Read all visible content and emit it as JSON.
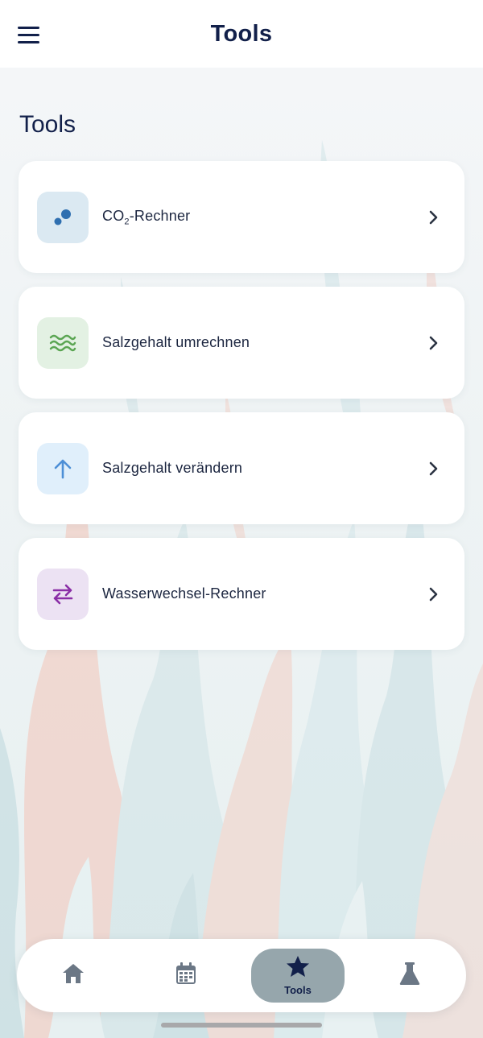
{
  "header": {
    "title": "Tools",
    "menu_icon": "hamburger-menu-icon"
  },
  "page": {
    "heading": "Tools"
  },
  "tools": [
    {
      "label_main": "CO",
      "label_sub": "2",
      "label_rest": "-Rechner",
      "icon": "bubbles-icon",
      "icon_bg": "#dbe9f2",
      "icon_color": "#2f6fb0"
    },
    {
      "label": "Salzgehalt umrechnen",
      "icon": "waves-icon",
      "icon_bg": "#e3f1e3",
      "icon_color": "#5aa552"
    },
    {
      "label": "Salzgehalt verändern",
      "icon": "arrow-up-icon",
      "icon_bg": "#e0effb",
      "icon_color": "#4d8fd6"
    },
    {
      "label": "Wasserwechsel-Rechner",
      "icon": "swap-arrows-icon",
      "icon_bg": "#ece2f3",
      "icon_color": "#8a2ea6"
    }
  ],
  "bottom_nav": {
    "items": [
      {
        "name": "home",
        "icon": "home-icon"
      },
      {
        "name": "calendar",
        "icon": "calendar-icon"
      },
      {
        "name": "tools",
        "icon": "star-icon",
        "label": "Tools",
        "active": true
      },
      {
        "name": "lab",
        "icon": "flask-icon"
      }
    ]
  },
  "colors": {
    "primary_text": "#12204a",
    "active_nav_bg": "#96a6ac",
    "icon_gray": "#6b7785"
  }
}
